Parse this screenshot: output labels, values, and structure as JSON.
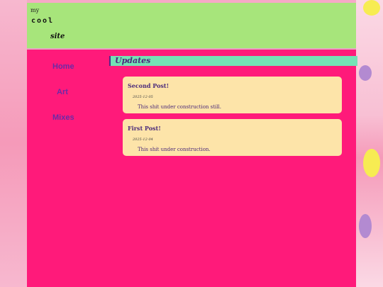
{
  "colors": {
    "header_bg": "#a7e57b",
    "page_bg": "#ff1a7a",
    "updates_bar_bg": "#74e2b5",
    "post_bg": "#fde4a9",
    "nav_link": "#6b2aa6"
  },
  "header": {
    "title_line1": "my",
    "title_line2": "cool",
    "title_line3": "site"
  },
  "nav": {
    "items": [
      {
        "label": "Home"
      },
      {
        "label": "Art"
      },
      {
        "label": "Mixes"
      }
    ]
  },
  "main": {
    "section_title": "Updates",
    "posts": [
      {
        "title": "Second Post!",
        "date": "2025-12-05",
        "body": "This shit under construction still."
      },
      {
        "title": "First Post!",
        "date": "2025-12-04",
        "body": "This shit under construction."
      }
    ]
  }
}
